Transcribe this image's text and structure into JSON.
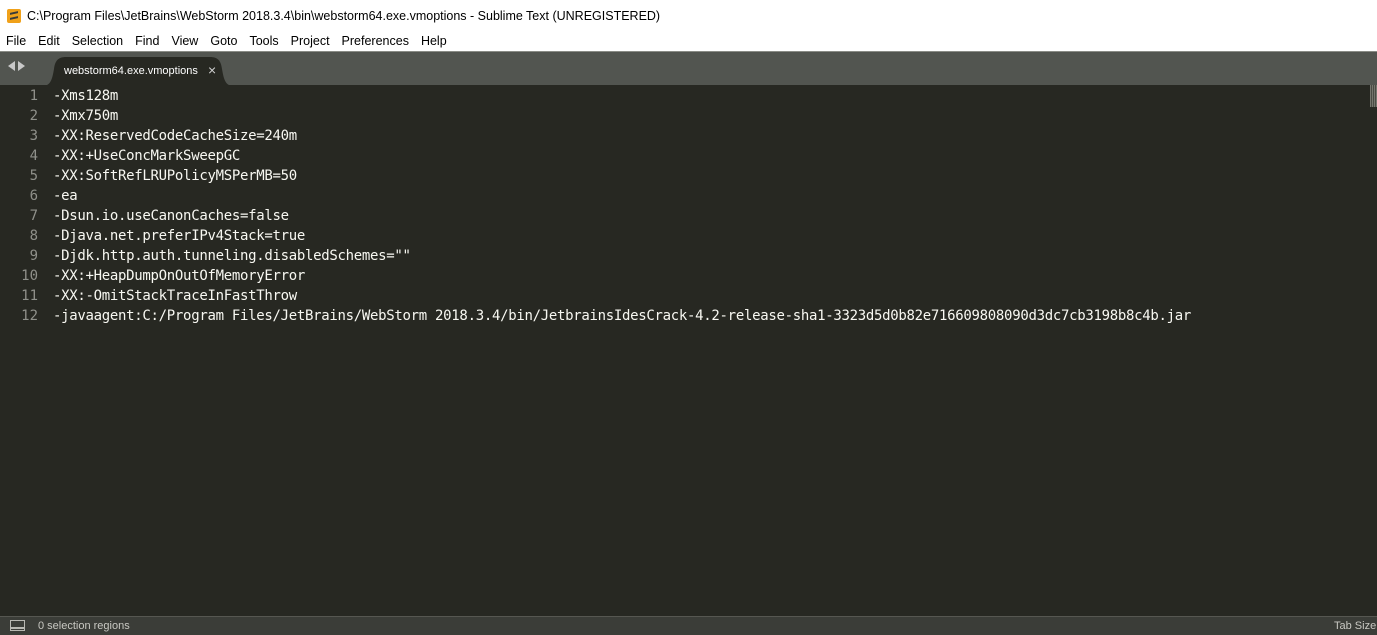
{
  "window": {
    "title": "C:\\Program Files\\JetBrains\\WebStorm 2018.3.4\\bin\\webstorm64.exe.vmoptions - Sublime Text (UNREGISTERED)",
    "icon": "sublime-text-icon"
  },
  "menu": {
    "items": [
      "File",
      "Edit",
      "Selection",
      "Find",
      "View",
      "Goto",
      "Tools",
      "Project",
      "Preferences",
      "Help"
    ]
  },
  "tabs": [
    {
      "label": "webstorm64.exe.vmoptions",
      "close": "×",
      "active": true
    }
  ],
  "editor": {
    "line_numbers": [
      "1",
      "2",
      "3",
      "4",
      "5",
      "6",
      "7",
      "8",
      "9",
      "10",
      "11",
      "12"
    ],
    "lines": [
      "-Xms128m",
      "-Xmx750m",
      "-XX:ReservedCodeCacheSize=240m",
      "-XX:+UseConcMarkSweepGC",
      "-XX:SoftRefLRUPolicyMSPerMB=50",
      "-ea",
      "-Dsun.io.useCanonCaches=false",
      "-Djava.net.preferIPv4Stack=true",
      "-Djdk.http.auth.tunneling.disabledSchemes=\"\"",
      "-XX:+HeapDumpOnOutOfMemoryError",
      "-XX:-OmitStackTraceInFastThrow",
      "-javaagent:C:/Program Files/JetBrains/WebStorm 2018.3.4/bin/JetbrainsIdesCrack-4.2-release-sha1-3323d5d0b82e716609808090d3dc7cb3198b8c4b.jar"
    ]
  },
  "status": {
    "selection": "0 selection regions",
    "tab_size": "Tab Size:"
  },
  "colors": {
    "editor_bg": "#272822",
    "text": "#f8f8f2",
    "gutter_text": "#8f908a",
    "tabbar_bg": "#525550",
    "statusbar_bg": "#3b3d38"
  }
}
